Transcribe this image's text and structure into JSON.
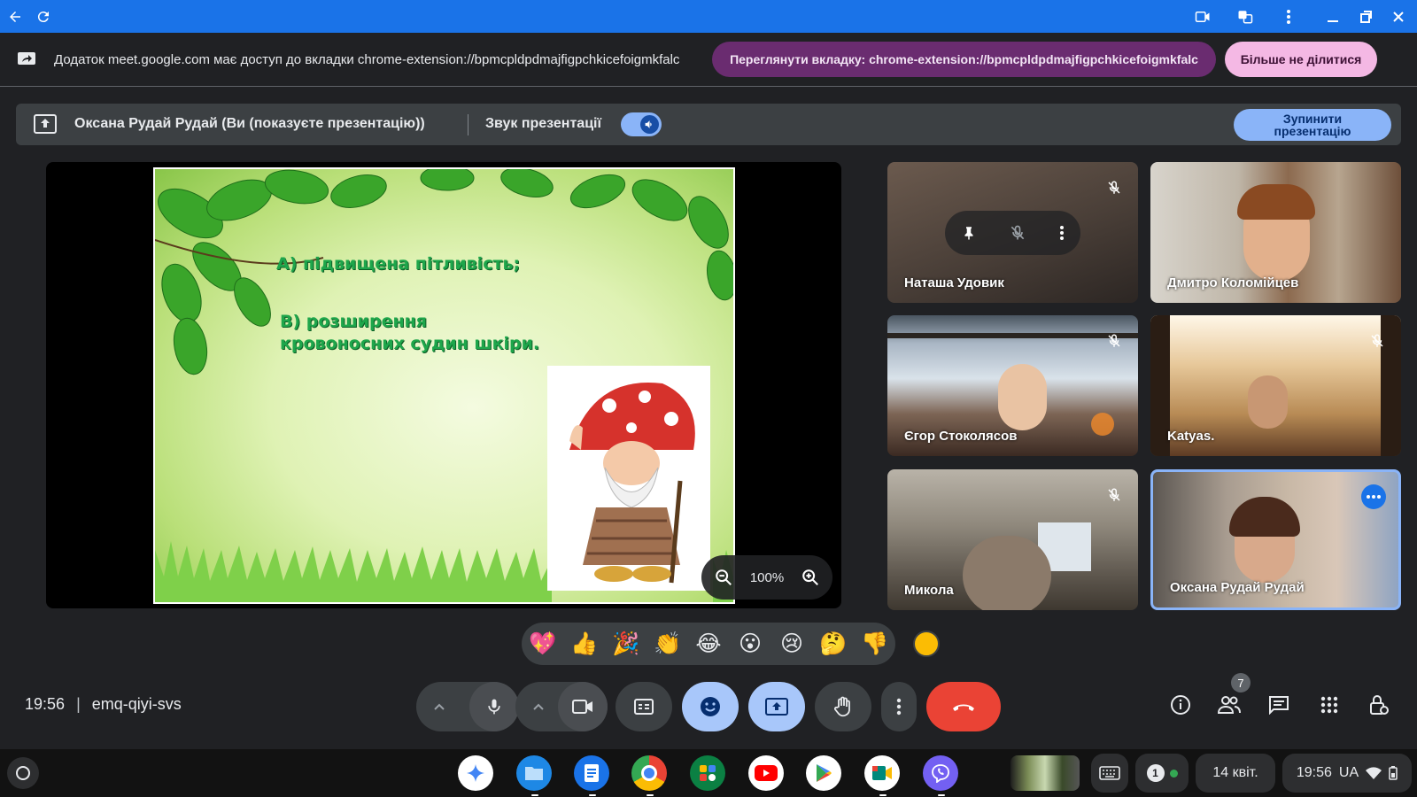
{
  "titlebar": {
    "icons": [
      "back-arrow-icon",
      "reload-icon",
      "cast-icon",
      "translate-icon",
      "more-vert-icon",
      "minimize-icon",
      "restore-icon",
      "close-icon"
    ]
  },
  "infobar": {
    "text": "Додаток meet.google.com має доступ до вкладки chrome-extension://bpmcpldpdmajfigpchkicefoigmkfalc",
    "view_tab_label": "Переглянути вкладку: chrome-extension://bpmcpldpdmajfigpchkicefoigmkfalc",
    "stop_share_label": "Більше не ділитися"
  },
  "presenting": {
    "presenter": "Оксана Рудай Рудай (Ви (показуєте презентацію))",
    "audio_label": "Звук презентації",
    "audio_on": true,
    "stop_label_1": "Зупинити",
    "stop_label_2": "презентацію"
  },
  "slide": {
    "line_a": "А) підвищена пітливість;",
    "line_b1": "В) розширення",
    "line_b2": "кровоносних судин шкіри.",
    "zoom": "100%"
  },
  "tiles": [
    {
      "name": "Наташа Удовик",
      "muted": true,
      "hover": true
    },
    {
      "name": "Дмитро Коломійцев",
      "muted": false
    },
    {
      "name": "Єгор Стоколясов",
      "muted": true
    },
    {
      "name": "Katyas.",
      "muted": true
    },
    {
      "name": "Микола",
      "muted": true
    },
    {
      "name": "Оксана Рудай Рудай",
      "muted": false,
      "self": true
    }
  ],
  "reactions": [
    "💖",
    "👍",
    "🎉",
    "👏",
    "😂",
    "😮",
    "😢",
    "🤔",
    "👎"
  ],
  "meeting": {
    "time": "19:56",
    "separator": "|",
    "code": "emq-qiyi-svs"
  },
  "controls": {
    "participants_count": "7"
  },
  "colors": {
    "blue": "#1a73e8",
    "light_blue": "#a8c7fa",
    "red": "#ea4335",
    "dark": "#202124",
    "purple": "#6a2c70",
    "pink": "#f4b8e4"
  },
  "shelf": {
    "apps": [
      "assistant-icon",
      "files-icon",
      "docs-icon",
      "chrome-icon",
      "apps-icon",
      "youtube-icon",
      "play-store-icon",
      "meet-icon",
      "viber-icon"
    ],
    "notifications": "1",
    "date": "14 квіт.",
    "clock": "19:56",
    "lang": "UA"
  }
}
